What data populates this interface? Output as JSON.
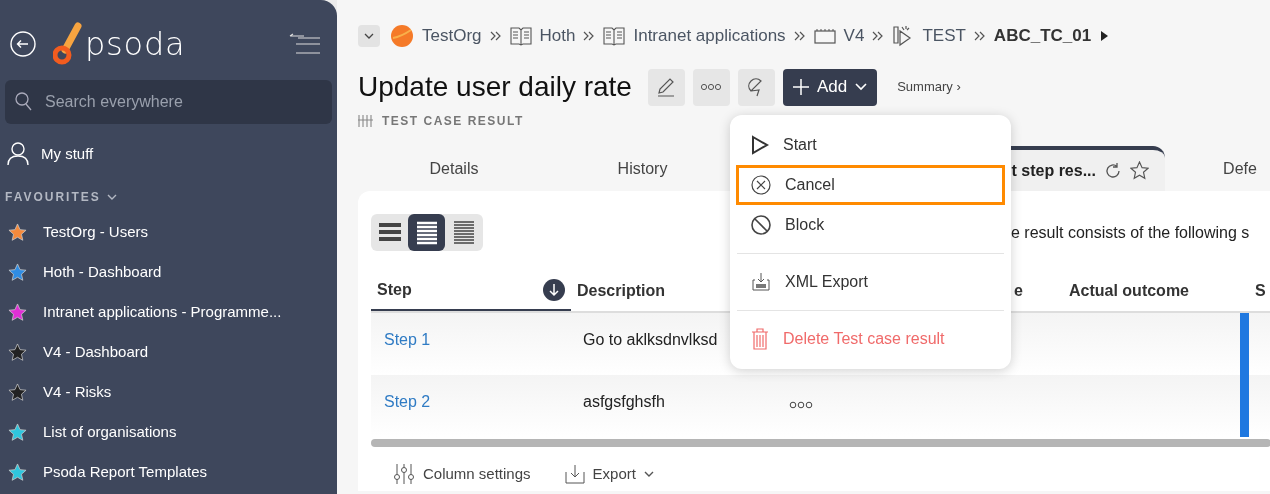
{
  "sidebar": {
    "logo": "psoda",
    "search": {
      "placeholder": "Search everywhere"
    },
    "my_stuff": "My stuff",
    "favourites": {
      "label": "FAVOURITES",
      "expanded": true,
      "items": [
        {
          "label": "TestOrg - Users",
          "color": "#f58a3c"
        },
        {
          "label": "Hoth - Dashboard",
          "color": "#2f8de4"
        },
        {
          "label": "Intranet applications - Programme...",
          "color": "#e02fd6"
        },
        {
          "label": "V4 - Dashboard",
          "color": "#222222"
        },
        {
          "label": "V4 - Risks",
          "color": "#222222"
        },
        {
          "label": "List of organisations",
          "color": "#2fc6dd"
        },
        {
          "label": "Psoda Report Templates",
          "color": "#2fc6dd"
        }
      ]
    }
  },
  "breadcrumb": [
    {
      "label": "TestOrg",
      "kind": "org"
    },
    {
      "label": "Hoth",
      "kind": "book"
    },
    {
      "label": "Intranet applications",
      "kind": "book"
    },
    {
      "label": "V4",
      "kind": "board"
    },
    {
      "label": "TEST",
      "kind": "test"
    },
    {
      "label": "ABC_TC_01",
      "kind": "current"
    }
  ],
  "title": "Update user daily rate",
  "subtitle": "TEST CASE RESULT",
  "add_button": "Add",
  "summary_link": "Summary ›",
  "tabs": [
    {
      "label": "Details",
      "selected": false
    },
    {
      "label": "History",
      "selected": false
    },
    {
      "label": "t step res...",
      "selected": true
    },
    {
      "label": "Defe",
      "selected": false
    }
  ],
  "view_modes": [
    {
      "selected": false
    },
    {
      "selected": true
    },
    {
      "selected": false
    }
  ],
  "intro": "e result consists of the following s",
  "table": {
    "columns": [
      "Step",
      "Description",
      "e",
      "Actual outcome",
      "S"
    ],
    "rows": [
      {
        "step": "Step 1",
        "description": "Go to aklksdnvlksd",
        "has_more": false
      },
      {
        "step": "Step 2",
        "description": "asfgsfghsfh",
        "has_more": true
      }
    ]
  },
  "footer": {
    "column_settings": "Column settings",
    "export": "Export"
  },
  "menu": [
    {
      "label": "Start",
      "kind": "start",
      "highlighted": false,
      "divider_before": false
    },
    {
      "label": "Cancel",
      "kind": "cancel",
      "highlighted": true,
      "divider_before": false
    },
    {
      "label": "Block",
      "kind": "block",
      "highlighted": false,
      "divider_before": false
    },
    {
      "label": "XML Export",
      "kind": "xml",
      "highlighted": false,
      "divider_before": true
    },
    {
      "label": "Delete Test case result",
      "kind": "delete",
      "highlighted": false,
      "divider_before": true
    }
  ]
}
